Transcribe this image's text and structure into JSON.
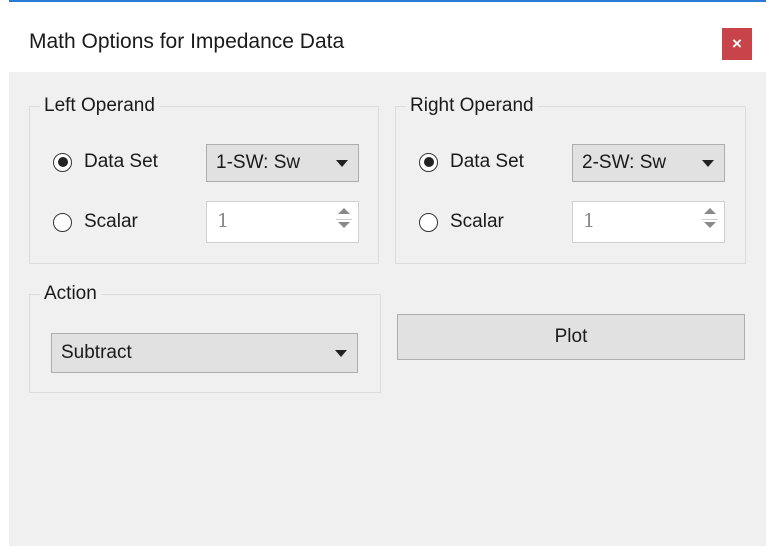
{
  "window": {
    "title": "Math Options for Impedance Data",
    "close_label": "×",
    "accent_color": "#2b7bd6",
    "close_color": "#c9444a"
  },
  "left_operand": {
    "legend": "Left Operand",
    "data_set_label": "Data Set",
    "data_set_selected": true,
    "data_set_value": "1-SW: Sw",
    "scalar_label": "Scalar",
    "scalar_selected": false,
    "scalar_value": "1"
  },
  "right_operand": {
    "legend": "Right Operand",
    "data_set_label": "Data Set",
    "data_set_selected": true,
    "data_set_value": "2-SW: Sw",
    "scalar_label": "Scalar",
    "scalar_selected": false,
    "scalar_value": "1"
  },
  "action": {
    "legend": "Action",
    "value": "Subtract"
  },
  "plot_button": {
    "label": "Plot"
  }
}
